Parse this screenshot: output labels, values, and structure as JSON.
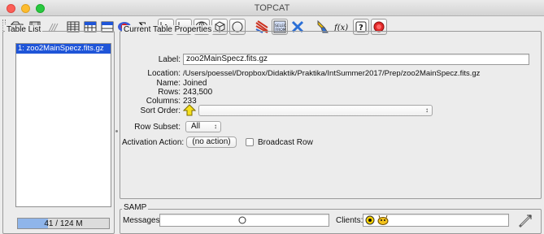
{
  "window": {
    "title": "TOPCAT"
  },
  "toolbar": {
    "icons": [
      "open-icon",
      "save-icon",
      "broadcast-icon",
      "table-view-icon",
      "column-info-icon",
      "parameters-icon",
      "subsets-icon",
      "statistics-icon",
      "histogram-icon",
      "plane-plot-icon",
      "sky-plot-icon",
      "cube-plot-icon",
      "sphere-plot-icon",
      "match-icon",
      "select-icon",
      "delete-icon",
      "help-icon",
      "functions-icon",
      "hint-icon",
      "stop-icon"
    ]
  },
  "table_list": {
    "legend": "Table List",
    "items": [
      "1: zoo2MainSpecz.fits.gz"
    ]
  },
  "memory": {
    "label": "41 / 124 M",
    "used_fraction": 0.33
  },
  "properties": {
    "legend": "Current Table Properties",
    "label_caption": "Label:",
    "label_value": "zoo2MainSpecz.fits.gz",
    "location_caption": "Location:",
    "location_value": "/Users/poessel/Dropbox/Didaktik/Praktika/IntSummer2017/Prep/zoo2MainSpecz.fits.gz",
    "name_caption": "Name:",
    "name_value": "Joined",
    "rows_caption": "Rows:",
    "rows_value": "243,500",
    "columns_caption": "Columns:",
    "columns_value": "233",
    "sort_caption": "Sort Order:",
    "sort_value": "",
    "subset_caption": "Row Subset:",
    "subset_value": "All",
    "activation_caption": "Activation Action:",
    "activation_value": "(no action)",
    "broadcast_label": "Broadcast Row"
  },
  "samp": {
    "legend": "SAMP",
    "messages_caption": "Messages:",
    "clients_caption": "Clients:"
  }
}
